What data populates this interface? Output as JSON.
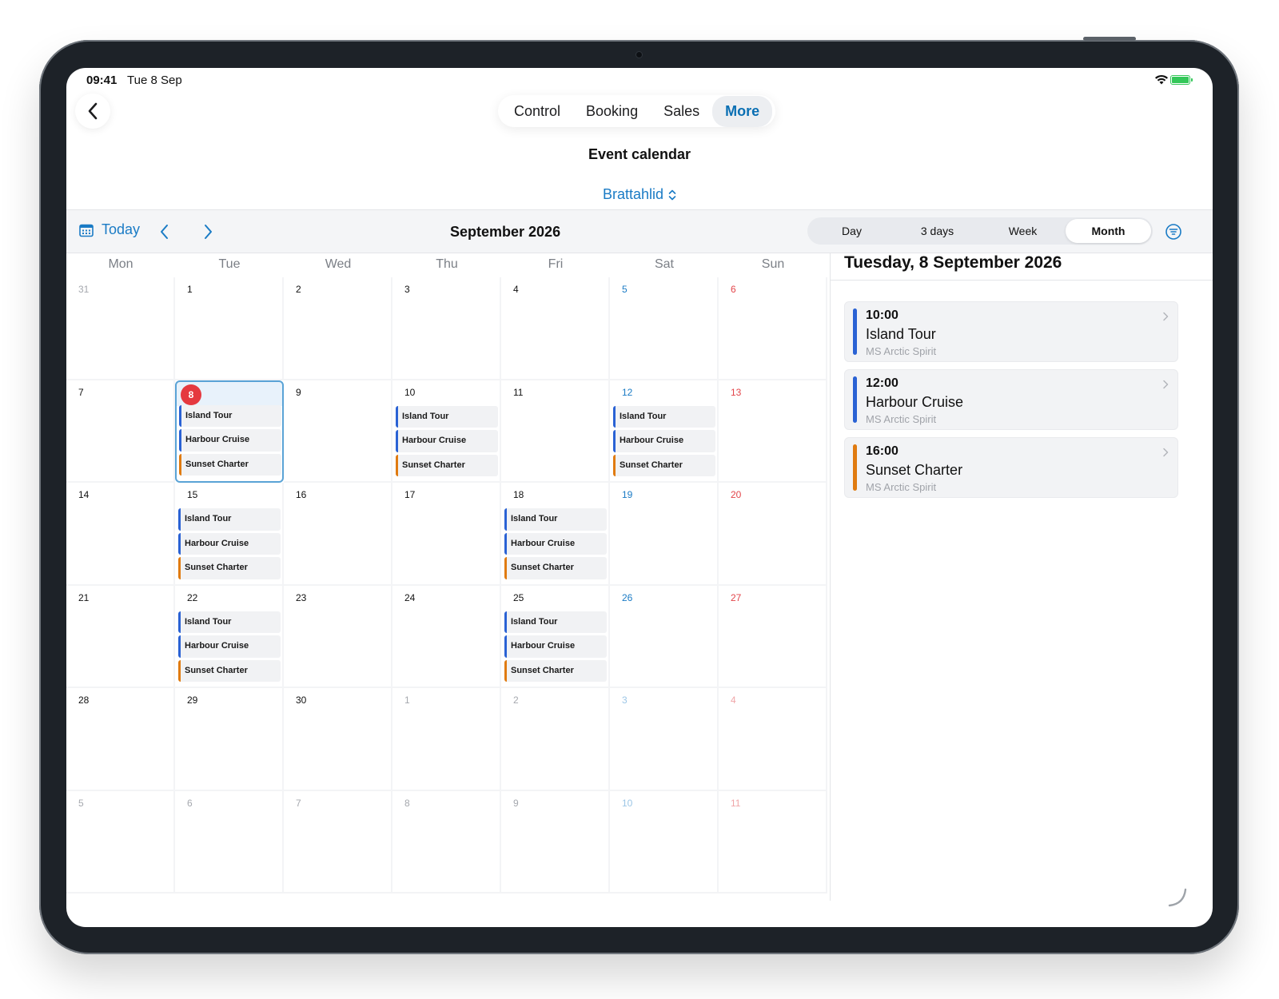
{
  "status": {
    "time": "09:41",
    "date": "Tue 8 Sep"
  },
  "nav": {
    "tabs": [
      {
        "label": "Control"
      },
      {
        "label": "Booking"
      },
      {
        "label": "Sales"
      },
      {
        "label": "More",
        "active": true
      }
    ]
  },
  "page": {
    "title": "Event calendar",
    "location": "Brattahlid"
  },
  "toolbar": {
    "today_label": "Today",
    "month_title": "September 2026",
    "views": [
      "Day",
      "3 days",
      "Week",
      "Month"
    ],
    "active_view": "Month"
  },
  "calendar": {
    "weekdays": [
      "Mon",
      "Tue",
      "Wed",
      "Thu",
      "Fri",
      "Sat",
      "Sun"
    ],
    "selected_day": "8",
    "days": [
      {
        "n": "31",
        "muted": true
      },
      {
        "n": "1"
      },
      {
        "n": "2"
      },
      {
        "n": "3"
      },
      {
        "n": "4"
      },
      {
        "n": "5"
      },
      {
        "n": "6"
      },
      {
        "n": "7"
      },
      {
        "n": "8",
        "selected": true,
        "events": true
      },
      {
        "n": "9"
      },
      {
        "n": "10",
        "events": true
      },
      {
        "n": "11"
      },
      {
        "n": "12",
        "events": true
      },
      {
        "n": "13"
      },
      {
        "n": "14"
      },
      {
        "n": "15",
        "events": true
      },
      {
        "n": "16"
      },
      {
        "n": "17"
      },
      {
        "n": "18",
        "events": true
      },
      {
        "n": "19"
      },
      {
        "n": "20"
      },
      {
        "n": "21"
      },
      {
        "n": "22",
        "events": true
      },
      {
        "n": "23"
      },
      {
        "n": "24"
      },
      {
        "n": "25",
        "events": true
      },
      {
        "n": "26"
      },
      {
        "n": "27"
      },
      {
        "n": "28"
      },
      {
        "n": "29"
      },
      {
        "n": "30"
      },
      {
        "n": "1",
        "muted": true
      },
      {
        "n": "2",
        "muted": true
      },
      {
        "n": "3",
        "muted": true
      },
      {
        "n": "4",
        "muted": true
      },
      {
        "n": "5",
        "muted": true
      },
      {
        "n": "6",
        "muted": true
      },
      {
        "n": "7",
        "muted": true
      },
      {
        "n": "8",
        "muted": true
      },
      {
        "n": "9",
        "muted": true
      },
      {
        "n": "10",
        "muted": true
      },
      {
        "n": "11",
        "muted": true
      }
    ],
    "event_labels": [
      {
        "label": "Island Tour",
        "color": "#2a62d4"
      },
      {
        "label": "Harbour Cruise",
        "color": "#2a62d4"
      },
      {
        "label": "Sunset Charter",
        "color": "#e07b10"
      }
    ]
  },
  "side": {
    "title": "Tuesday, 8 September 2026",
    "events": [
      {
        "time": "10:00",
        "name": "Island Tour",
        "vessel": "MS Arctic Spirit",
        "color": "#2a62d4"
      },
      {
        "time": "12:00",
        "name": "Harbour Cruise",
        "vessel": "MS Arctic Spirit",
        "color": "#2a62d4"
      },
      {
        "time": "16:00",
        "name": "Sunset Charter",
        "vessel": "MS Arctic Spirit",
        "color": "#e07b10"
      }
    ]
  },
  "colors": {
    "accent": "#1a7bc5",
    "today": "#e5393f",
    "weekend_sat": "#1a7bc5",
    "weekend_sun": "#e3454a"
  },
  "icons": {
    "back": "chevron-left-icon",
    "location_toggle": "chevron-up-down-icon",
    "today": "calendar-icon",
    "prev": "chevron-left-icon",
    "next": "chevron-right-icon",
    "filter": "filter-icon"
  }
}
